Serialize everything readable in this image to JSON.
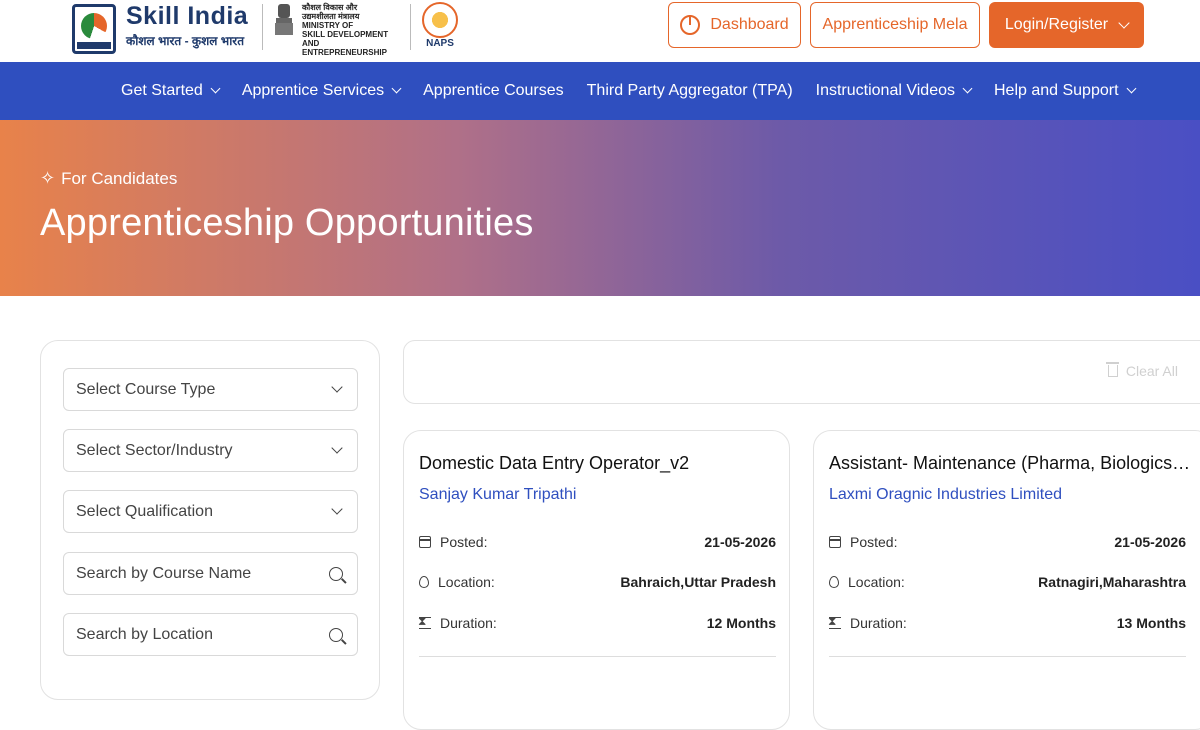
{
  "header": {
    "brand_title": "Skill India",
    "brand_subtitle": "कौशल भारत - कुशल भारत",
    "ministry_lines": [
      "कौशल विकास और",
      "उद्यमशीलता मंत्रालय",
      "MINISTRY OF",
      "SKILL DEVELOPMENT",
      "AND ENTREPRENEURSHIP"
    ],
    "emblem_caption": "सत्यमेव जयते",
    "naps_label": "NAPS",
    "dashboard_label": "Dashboard",
    "mela_label": "Apprenticeship Mela",
    "login_label": "Login/Register"
  },
  "nav": {
    "items": [
      {
        "label": "Get Started",
        "dropdown": true
      },
      {
        "label": "Apprentice Services",
        "dropdown": true
      },
      {
        "label": "Apprentice Courses",
        "dropdown": false
      },
      {
        "label": "Third Party Aggregator (TPA)",
        "dropdown": false
      },
      {
        "label": "Instructional Videos",
        "dropdown": true
      },
      {
        "label": "Help and Support",
        "dropdown": true
      }
    ]
  },
  "hero": {
    "tag": "For Candidates",
    "title": "Apprenticeship Opportunities"
  },
  "filters": {
    "course_type": "Select Course Type",
    "sector": "Select Sector/Industry",
    "qualification": "Select Qualification",
    "course_name_placeholder": "Search by Course Name",
    "location_placeholder": "Search by Location"
  },
  "results": {
    "clear_all": "Clear All",
    "cards": [
      {
        "title": "Domestic Data Entry Operator_v2",
        "company": "Sanjay Kumar Tripathi",
        "posted_label": "Posted:",
        "posted": "21-05-2026",
        "location_label": "Location:",
        "location": "Bahraich,Uttar Pradesh",
        "duration_label": "Duration:",
        "duration": "12 Months"
      },
      {
        "title": "Assistant- Maintenance (Pharma, Biologics A...",
        "company": "Laxmi Oragnic Industries Limited",
        "posted_label": "Posted:",
        "posted": "21-05-2026",
        "location_label": "Location:",
        "location": "Ratnagiri,Maharashtra",
        "duration_label": "Duration:",
        "duration": "13 Months"
      }
    ]
  },
  "colors": {
    "accent_orange": "#e5662a",
    "nav_blue": "#2f4fbf",
    "brand_navy": "#1f3a6b"
  }
}
